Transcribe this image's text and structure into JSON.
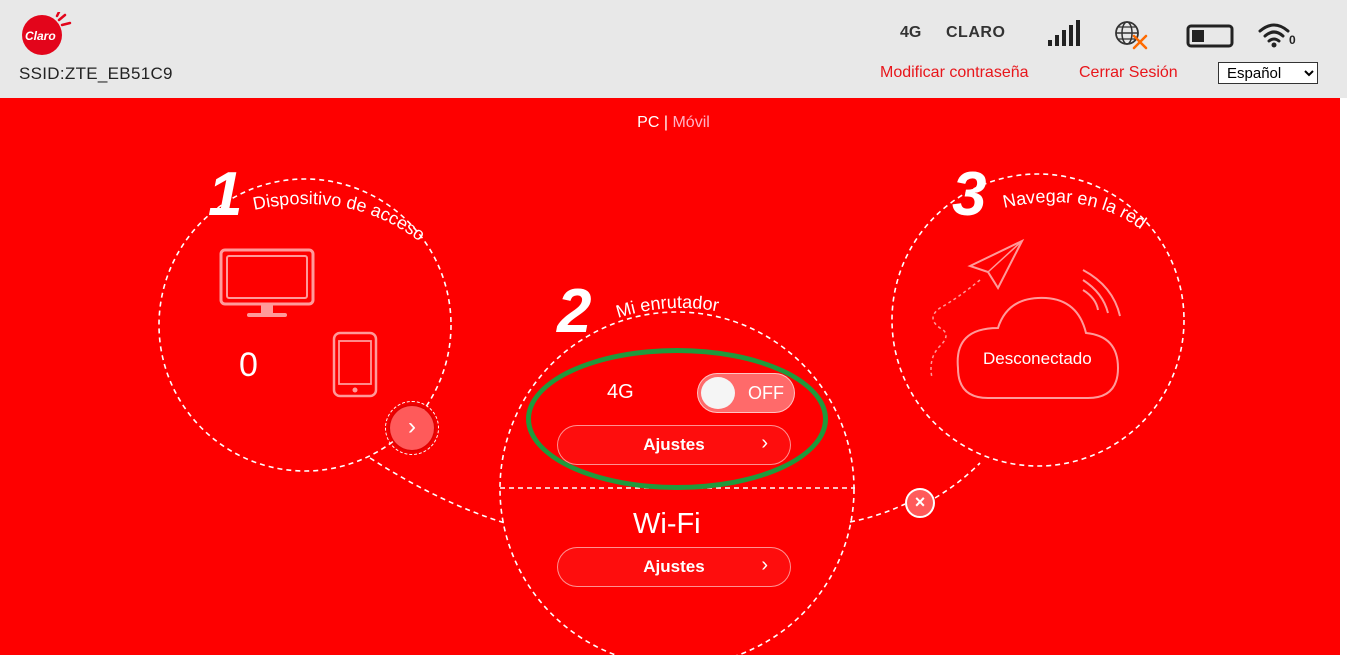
{
  "header": {
    "logo_text": "Claro",
    "ssid": "SSID:ZTE_EB51C9",
    "network_type": "4G",
    "carrier": "CLARO",
    "links": {
      "change_password": "Modificar contraseña",
      "logout": "Cerrar Sesión"
    },
    "language": {
      "selected": "Español",
      "options": [
        "Español"
      ]
    },
    "wifi_clients": "0"
  },
  "mode_switch": {
    "pc": "PC",
    "separator": "|",
    "mobile": "Móvil"
  },
  "section1": {
    "number": "1",
    "title": "Dispositivo de acceso",
    "device_count": "0"
  },
  "section2": {
    "number": "2",
    "title": "Mi enrutador",
    "mobile_label": "4G",
    "toggle_state": "OFF",
    "mobile_settings": "Ajustes",
    "wifi_label": "Wi-Fi",
    "wifi_settings": "Ajustes"
  },
  "section3": {
    "number": "3",
    "title": "Navegar en la red",
    "status": "Desconectado"
  },
  "colors": {
    "background": "#fe0000",
    "header": "#e8e8e8",
    "link": "#e8161b",
    "highlight": "#1f9a3c"
  }
}
